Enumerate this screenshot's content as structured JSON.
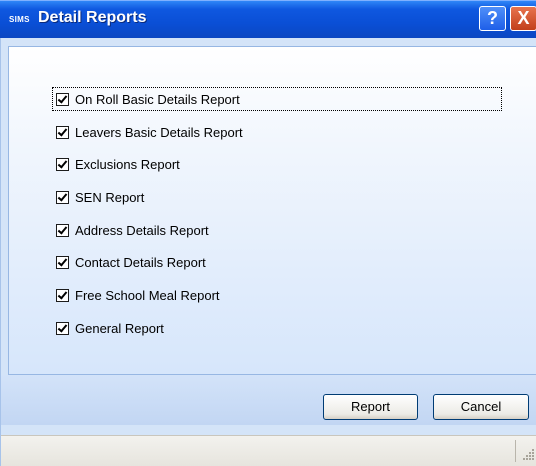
{
  "window": {
    "logo_text": "SIMS",
    "title": "Detail Reports",
    "help_glyph": "?",
    "close_glyph": "X"
  },
  "reports": [
    {
      "label": "On Roll Basic Details Report",
      "checked": true
    },
    {
      "label": "Leavers Basic Details Report",
      "checked": true
    },
    {
      "label": "Exclusions Report",
      "checked": true
    },
    {
      "label": "SEN Report",
      "checked": true
    },
    {
      "label": "Address Details Report",
      "checked": true
    },
    {
      "label": "Contact Details Report",
      "checked": true
    },
    {
      "label": "Free School Meal Report",
      "checked": true
    },
    {
      "label": "General Report",
      "checked": true
    }
  ],
  "buttons": {
    "report_label": "Report",
    "cancel_label": "Cancel"
  }
}
